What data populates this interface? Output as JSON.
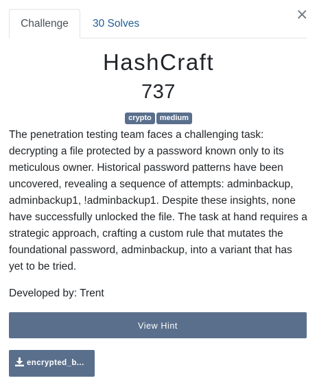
{
  "tabs": [
    {
      "label": "Challenge",
      "active": true
    },
    {
      "label": "30 Solves",
      "active": false
    }
  ],
  "close_symbol": "×",
  "challenge": {
    "name": "HashCraft",
    "points": "737",
    "tags": [
      "crypto",
      "medium"
    ],
    "description": "The penetration testing team faces a challenging task: decrypting a file protected by a password known only to its meticulous owner. Historical password patterns have been uncovered, revealing a sequence of attempts: adminbackup, adminbackup1, !adminbackup1. Despite these insights, none have successfully unlocked the file. The task at hand requires a strategic approach, crafting a custom rule that mutates the foundational password, adminbackup, into a variant that has yet to be tried.",
    "developer": "Developed by: Trent"
  },
  "hint_button_label": "View Hint",
  "file": {
    "label": "encrypted_b...",
    "icon": "download-icon"
  },
  "colors": {
    "button": "#5a6f8c",
    "link": "#1f5d96",
    "text": "#212529"
  }
}
